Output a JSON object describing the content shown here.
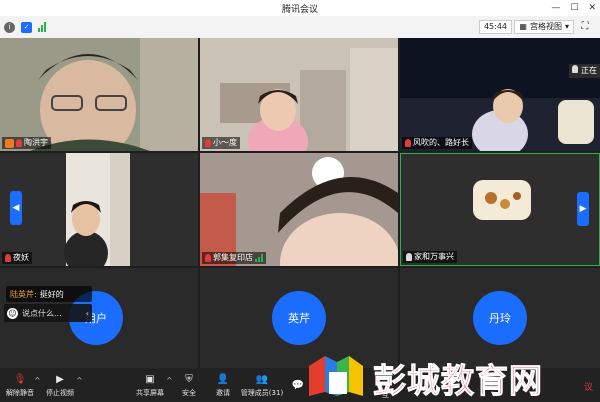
{
  "app_title": "腾讯会议",
  "timer": "45:44",
  "view_mode": "宫格视图",
  "participants": [
    {
      "name": "陶洪宇",
      "tile": "video-man"
    },
    {
      "name": "小～度",
      "tile": "video-girl-kitchen"
    },
    {
      "name": "风吹的、路好长",
      "tile": "video-girl-night"
    },
    {
      "name": "夜妖",
      "tile": "video-boy"
    },
    {
      "name": "郭集复印店",
      "tile": "video-girl-close"
    },
    {
      "name": "家和万事兴",
      "tile": "screen-share"
    },
    {
      "name": "用户",
      "avatar": "用户"
    },
    {
      "name": "英芹",
      "avatar": "英芹"
    },
    {
      "name": "丹玲",
      "avatar": "丹玲"
    }
  ],
  "overlay_partial_label": "正在",
  "chat": {
    "sender": "陆英芹:",
    "message": "挺好的",
    "input_placeholder": "说点什么..."
  },
  "toolbar": {
    "unmute": "解除静音",
    "stop_video": "停止视频",
    "share_screen": "共享屏幕",
    "security": "安全",
    "invite": "邀请",
    "manage_members": "管理成员(31)",
    "interact_partial": "互",
    "record_partial": "议"
  },
  "watermark_text": "彭城教育网",
  "colors": {
    "accent": "#1a6dff",
    "bg": "#1e1e1e",
    "toolbar": "#222222",
    "watermark": "#e0102a"
  }
}
